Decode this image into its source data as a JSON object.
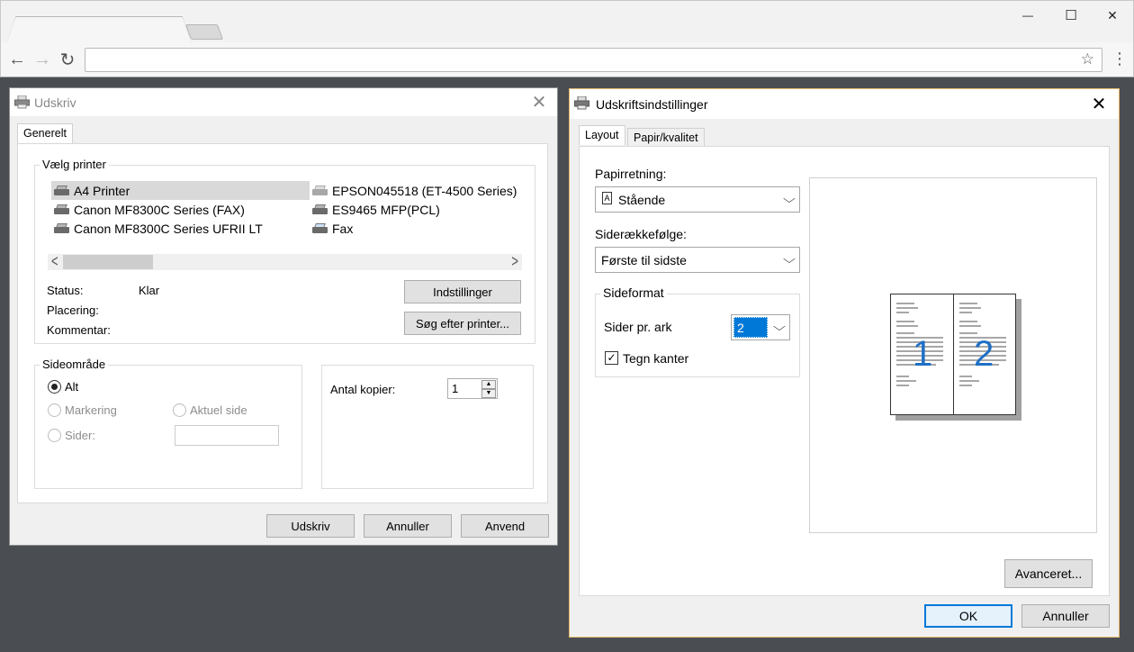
{
  "browser": {
    "window_controls": {
      "minimize": "—",
      "maximize": "☐",
      "close": "✕"
    },
    "nav": {
      "back": "←",
      "forward": "→",
      "reload": "↻"
    },
    "address_value": "",
    "star": "☆",
    "menu": "⋮"
  },
  "print_dialog": {
    "title": "Udskriv",
    "close": "✕",
    "tab": "Generelt",
    "select_printer_label": "Vælg printer",
    "printers": [
      {
        "name": "A4 Printer",
        "selected": true,
        "icon": "printer-icon"
      },
      {
        "name": "EPSON045518 (ET-4500 Series)",
        "selected": false,
        "icon": "printer-icon"
      },
      {
        "name": "Canon MF8300C Series (FAX)",
        "selected": false,
        "icon": "fax-printer-icon"
      },
      {
        "name": "ES9465 MFP(PCL)",
        "selected": false,
        "icon": "printer-icon"
      },
      {
        "name": "Canon MF8300C Series UFRII LT",
        "selected": false,
        "icon": "printer-icon"
      },
      {
        "name": "Fax",
        "selected": false,
        "icon": "fax-icon"
      }
    ],
    "scroll_left": "<",
    "scroll_right": ">",
    "status_label": "Status:",
    "status_value": "Klar",
    "location_label": "Placering:",
    "comment_label": "Kommentar:",
    "settings_button": "Indstillinger",
    "find_printer_button": "Søg efter printer...",
    "page_range_label": "Sideområde",
    "range_all": "Alt",
    "range_selection": "Markering",
    "range_current": "Aktuel side",
    "range_pages": "Sider:",
    "pages_value": "",
    "copies_label": "Antal kopier:",
    "copies_value": "1",
    "print_button": "Udskriv",
    "cancel_button": "Annuller",
    "apply_button": "Anvend"
  },
  "settings_dialog": {
    "title": "Udskriftsindstillinger",
    "close": "✕",
    "tabs": [
      "Layout",
      "Papir/kvalitet"
    ],
    "orientation_label": "Papirretning:",
    "orientation_value": "Stående",
    "page_order_label": "Siderækkefølge:",
    "page_order_value": "Første til sidste",
    "page_format_label": "Sideformat",
    "pages_per_sheet_label": "Sider pr. ark",
    "pages_per_sheet_value": "2",
    "draw_borders_label": "Tegn kanter",
    "draw_borders_checked": true,
    "checkmark": "✓",
    "preview_page_numbers": [
      "1",
      "2"
    ],
    "advanced_button": "Avanceret...",
    "ok_button": "OK",
    "cancel_button": "Annuller",
    "chevron": "⌵"
  },
  "colors": {
    "accent": "#0078d7",
    "selection": "#0078d7",
    "preview_numbers": "#1f6fc5"
  }
}
